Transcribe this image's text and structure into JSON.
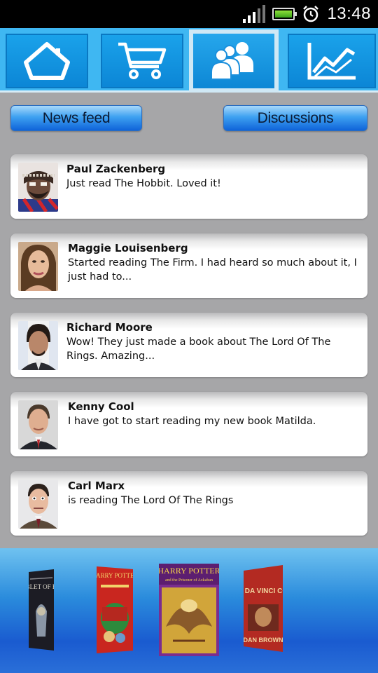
{
  "status_bar": {
    "time": "13:48",
    "icons": [
      "signal-icon",
      "battery-icon",
      "alarm-icon"
    ]
  },
  "nav": {
    "tabs": [
      {
        "icon": "home-icon",
        "active": false
      },
      {
        "icon": "cart-icon",
        "active": false
      },
      {
        "icon": "people-icon",
        "active": true
      },
      {
        "icon": "chart-icon",
        "active": false
      }
    ]
  },
  "segments": {
    "news_feed": "News feed",
    "discussions": "Discussions"
  },
  "feed": [
    {
      "name": "Paul Zackenberg",
      "text": "Just read The Hobbit. Loved it!"
    },
    {
      "name": "Maggie Louisenberg",
      "text": "Started reading The Firm. I had heard so much about it, I just had to..."
    },
    {
      "name": "Richard Moore",
      "text": "Wow! They just made a book about The Lord Of The Rings. Amazing..."
    },
    {
      "name": "Kenny Cool",
      "text": "I have got to start reading my new book Matilda."
    },
    {
      "name": "Carl Marx",
      "text": "is reading The Lord Of The Rings"
    }
  ],
  "carousel": {
    "books": [
      {
        "title": "GOBLET OF FIRE",
        "color": "#1b1b22"
      },
      {
        "title": "HARRY POTTER",
        "color": "#c9261f"
      },
      {
        "title": "HARRY POTTER",
        "subtitle": "and the Prisoner of Azkaban",
        "color": "#7a2d8f"
      },
      {
        "title": "THE DA VINCI CODE",
        "author": "DAN BROWN",
        "color": "#b32a22"
      }
    ]
  },
  "colors": {
    "nav_background": "#3fb7f2",
    "tab_blue": "#0c86d6",
    "page_background": "#a6a6a8",
    "carousel_blue": "#1a5bd0"
  }
}
